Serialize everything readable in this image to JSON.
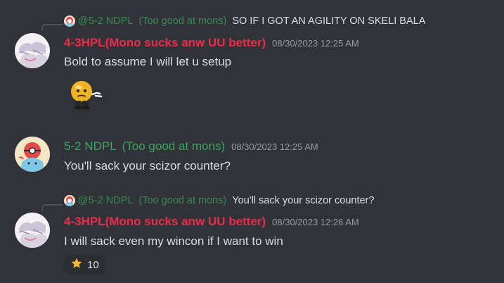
{
  "messages": [
    {
      "reply": {
        "author": "@5-2 NDPL",
        "role_tag": "(Too good at mons)",
        "text": "SO IF I GOT AN AGILITY ON SKELI BALA"
      },
      "author": "4-3HPL(Mono sucks anw UU better)",
      "timestamp": "08/30/2023 12:25 AM",
      "text": "Bold to assume I will let u setup",
      "sticker": "emoji-thinking-sticker"
    },
    {
      "author": "5-2 NDPL",
      "role_tag": "(Too good at mons)",
      "timestamp": "08/30/2023 12:25 AM",
      "text": "You'll sack your scizor counter?"
    },
    {
      "reply": {
        "author": "@5-2 NDPL",
        "role_tag": "(Too good at mons)",
        "text": "You'll sack your scizor counter?"
      },
      "author": "4-3HPL(Mono sucks anw UU better)",
      "timestamp": "08/30/2023 12:26 AM",
      "text": "I will sack even my wincon if I want to win",
      "reaction": {
        "icon": "star-icon",
        "count": "10"
      }
    }
  ],
  "colors": {
    "background": "#313338",
    "red_name": "#ed2b4b",
    "green_name": "#3ba55c",
    "text": "#dbdee1",
    "muted": "#949ba4"
  }
}
